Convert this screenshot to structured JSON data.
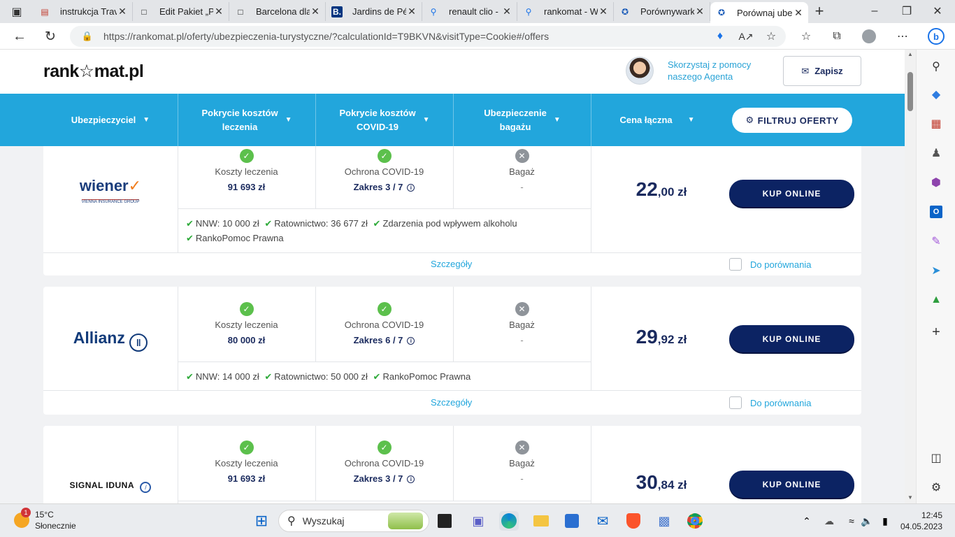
{
  "browser": {
    "tabs": [
      {
        "title": "instrukcja Trav",
        "icon": "pdf-icon"
      },
      {
        "title": "Edit Pakiet „PO",
        "icon": "document-icon"
      },
      {
        "title": "Barcelona dla",
        "icon": "document-icon"
      },
      {
        "title": "Jardins de Pér",
        "icon": "booking-icon"
      },
      {
        "title": "renault clio - (",
        "icon": "search-icon"
      },
      {
        "title": "rankomat - W",
        "icon": "search-icon"
      },
      {
        "title": "Porównywark",
        "icon": "rankomat-icon"
      },
      {
        "title": "Porównaj ube",
        "icon": "rankomat-icon"
      }
    ],
    "url_host": "https://rankomat.pl",
    "url_path": "/oferty/ubezpieczenia-turystyczne/?calculationId=T9BKVN&visitType=Cookie#/offers"
  },
  "site": {
    "logo": "rank☆mat.pl",
    "agent_line1": "Skorzystaj z pomocy",
    "agent_line2": "naszego Agenta",
    "save_label": "Zapisz"
  },
  "filterbar": {
    "col_insurer": "Ubezpieczyciel",
    "col_medical_1": "Pokrycie kosztów",
    "col_medical_2": "leczenia",
    "col_covid_1": "Pokrycie kosztów",
    "col_covid_2": "COVID-19",
    "col_baggage_1": "Ubezpieczenie",
    "col_baggage_2": "bagażu",
    "col_price": "Cena łączna",
    "filter_button": "FILTRUJ OFERTY"
  },
  "offers": [
    {
      "insurer": "wiener",
      "insurer_sub": "VIENNA INSURANCE GROUP",
      "medical_label": "Koszty leczenia",
      "medical_value": "91 693 zł",
      "covid_label": "Ochrona COVID-19",
      "covid_value": "Zakres 3 / 7",
      "baggage_label": "Bagaż",
      "baggage_value": "-",
      "extras_line1": [
        "NNW: 10 000 zł",
        "Ratownictwo: 36 677 zł",
        "Zdarzenia pod wpływem alkoholu"
      ],
      "extras_line2": [
        "RankoPomoc Prawna"
      ],
      "price_int": "22",
      "price_dec": ",00 zł",
      "buy_label": "KUP ONLINE",
      "details_label": "Szczegóły",
      "compare_label": "Do porównania"
    },
    {
      "insurer": "Allianz",
      "medical_label": "Koszty leczenia",
      "medical_value": "80 000 zł",
      "covid_label": "Ochrona COVID-19",
      "covid_value": "Zakres 6 / 7",
      "baggage_label": "Bagaż",
      "baggage_value": "-",
      "extras_line1": [
        "NNW: 14 000 zł",
        "Ratownictwo: 50 000 zł",
        "RankoPomoc Prawna"
      ],
      "price_int": "29",
      "price_dec": ",92 zł",
      "buy_label": "KUP ONLINE",
      "details_label": "Szczegóły",
      "compare_label": "Do porównania"
    },
    {
      "insurer": "SIGNAL IDUNA",
      "medical_label": "Koszty leczenia",
      "medical_value": "91 693 zł",
      "covid_label": "Ochrona COVID-19",
      "covid_value": "Zakres 3 / 7",
      "baggage_label": "Bagaż",
      "baggage_value": "-",
      "price_int": "30",
      "price_dec": ",84 zł",
      "buy_label": "KUP ONLINE"
    }
  ],
  "taskbar": {
    "weather_temp": "15°C",
    "weather_desc": "Słonecznie",
    "weather_badge": "1",
    "search_placeholder": "Wyszukaj",
    "time": "12:45",
    "date": "04.05.2023"
  },
  "colors": {
    "accent": "#22a6dc",
    "navy": "#0c2363",
    "ok_green": "#5cc04c"
  }
}
